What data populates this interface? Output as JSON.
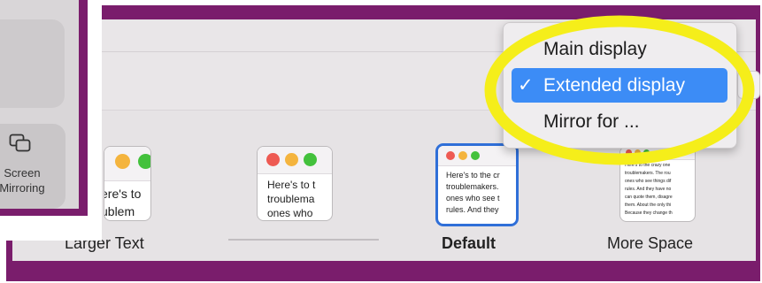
{
  "control_center": {
    "screen_mirroring_label_line1": "Screen",
    "screen_mirroring_label_line2": "Mirroring"
  },
  "display_menu": {
    "items": [
      {
        "label": "Main display",
        "checked": false
      },
      {
        "label": "Extended display",
        "checked": true
      },
      {
        "label": "Mirror for ...",
        "checked": false
      }
    ],
    "check_mark": "✓",
    "highlight_color": "#3c8cf6"
  },
  "resolution_options": [
    {
      "label": "Larger Text",
      "preview_text": [
        "ere's to",
        "ublem"
      ],
      "selected": false
    },
    {
      "label": "",
      "preview_text": [
        "Here's to t",
        "troublema",
        "ones who"
      ],
      "selected": false
    },
    {
      "label": "Default",
      "preview_text": [
        "Here's to the cr",
        "troublemakers.",
        "ones who see t",
        "rules. And they"
      ],
      "selected": true
    },
    {
      "label": "More Space",
      "preview_text": [
        "Here's to the crazy one",
        "troublemakers. The rou",
        "ones who see things dif",
        "rules. And they have no",
        "can quote them, disagre",
        "them. About the only thi",
        "Because they change th"
      ],
      "selected": false
    }
  ],
  "colors": {
    "frame_purple": "#7a1d6c",
    "annotation_yellow": "#f5ee1a",
    "selection_blue": "#2f6fd8"
  }
}
